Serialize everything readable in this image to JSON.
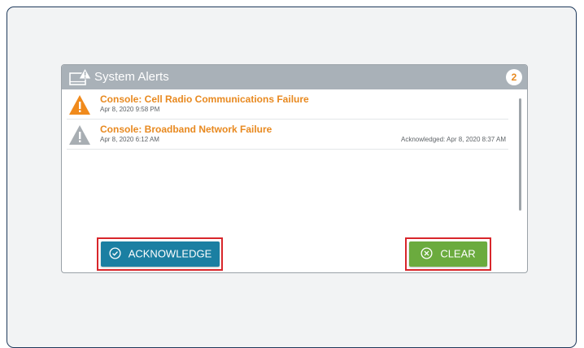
{
  "panel": {
    "title": "System Alerts",
    "count": "2"
  },
  "alerts": [
    {
      "title": "Console: Cell Radio Communications Failure",
      "time": "Apr 8, 2020 9:58 PM",
      "acknowledged": "",
      "icon": "warning-triangle-icon",
      "icon_color": "#f08a1c"
    },
    {
      "title": "Console: Broadband Network Failure",
      "time": "Apr 8, 2020 6:12 AM",
      "acknowledged": "Acknowledged: Apr 8, 2020 8:37 AM",
      "icon": "warning-triangle-icon",
      "icon_color": "#a8aeb3"
    }
  ],
  "buttons": {
    "acknowledge_label": "ACKNOWLEDGE",
    "acknowledge_icon": "check-circle-icon",
    "acknowledge_color": "#1b7fa2",
    "clear_label": "CLEAR",
    "clear_icon": "x-circle-icon",
    "clear_color": "#6bab3e",
    "highlight_color": "#d8262b"
  },
  "colors": {
    "alert_title": "#e8891f",
    "header": "#a9b1b8",
    "frame_border": "#1f3a5c"
  }
}
